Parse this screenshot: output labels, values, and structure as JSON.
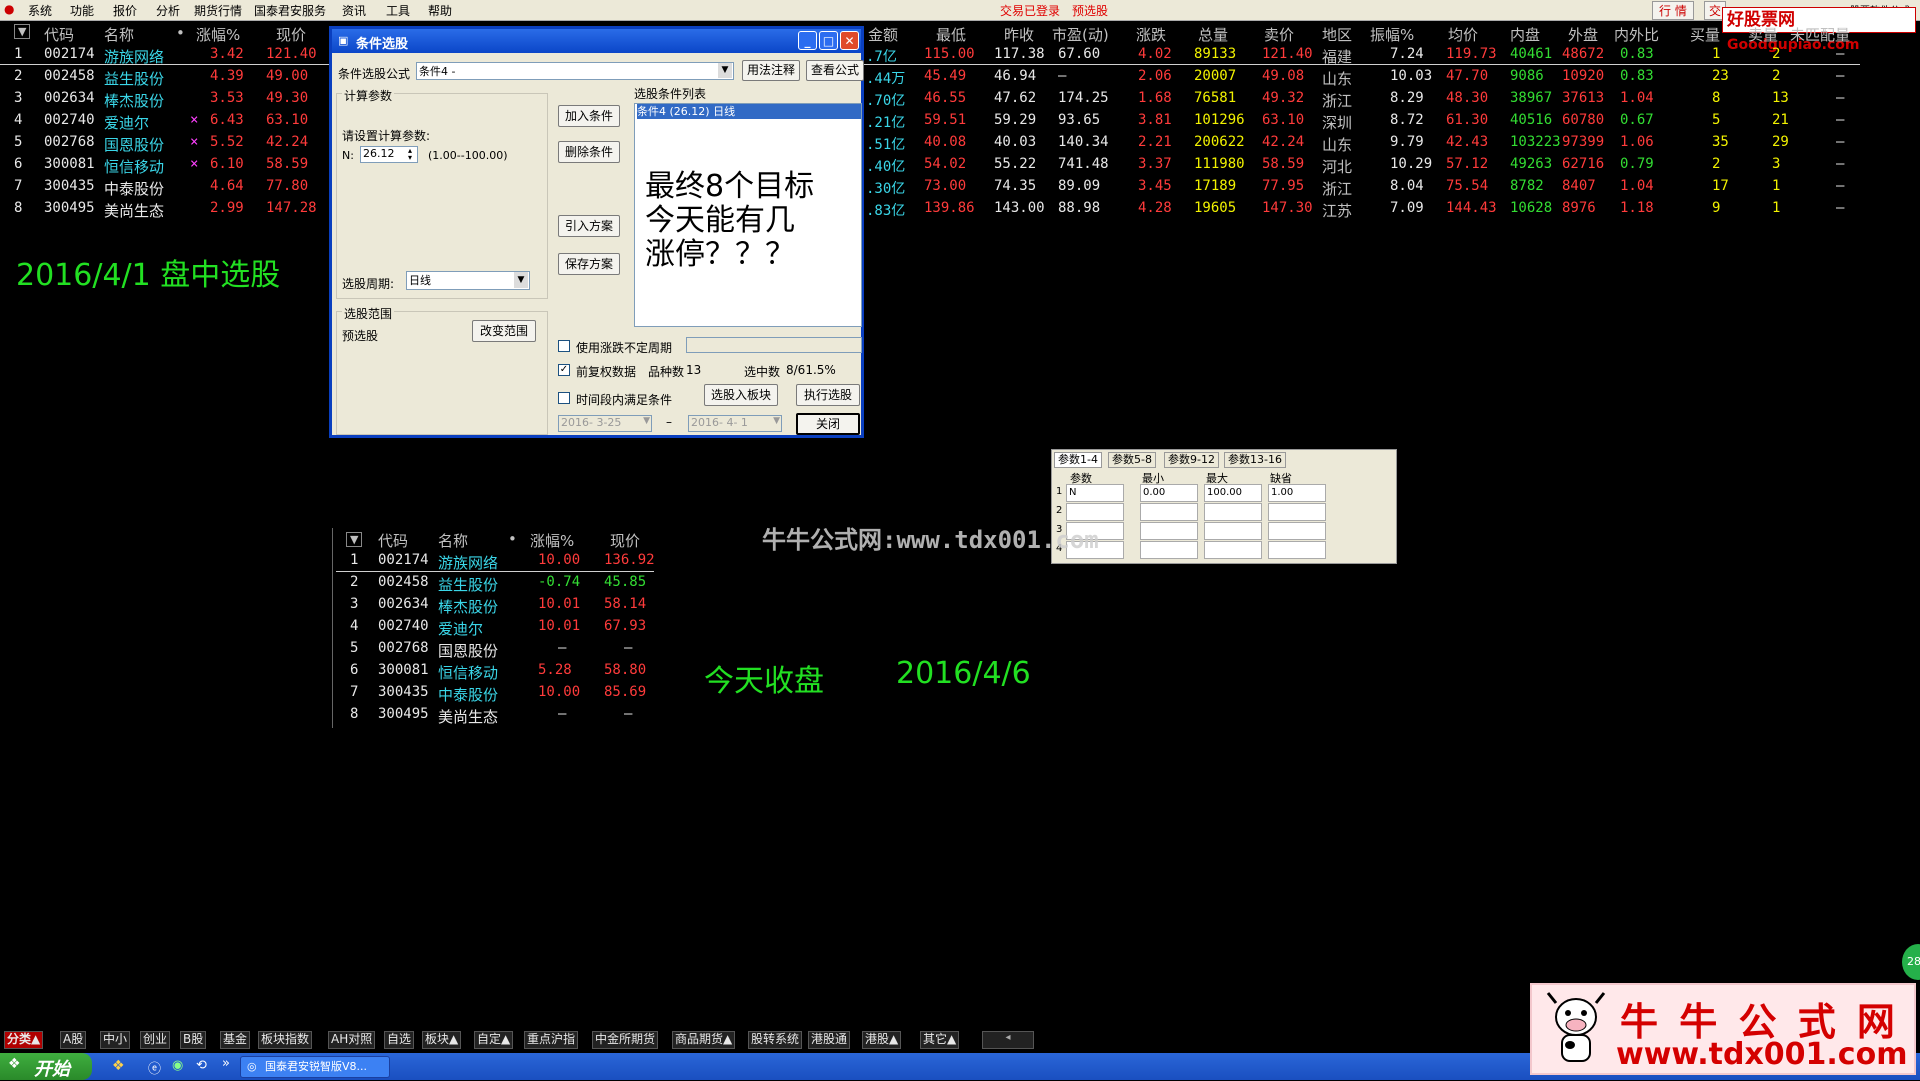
{
  "menubar": {
    "items": [
      "系统",
      "功能",
      "报价",
      "分析",
      "期货行情",
      "国泰君安服务",
      "资讯",
      "工具",
      "帮助"
    ],
    "status_login": "交易已登录",
    "status_pre": "预选股",
    "right_btn1": "行 情",
    "right_btn2": "交",
    "right_text": "股票软件公式"
  },
  "logo_top": {
    "cn": "好股票网",
    "en": "Goodgupiao.com"
  },
  "main_table": {
    "headers_left": [
      "代码",
      "名称",
      "•",
      "涨幅%",
      "现价"
    ],
    "headers_right": [
      "金额",
      "最低",
      "昨收",
      "市盈(动)",
      "涨跌",
      "总量",
      "卖价",
      "地区",
      "振幅%",
      "均价",
      "内盘",
      "外盘",
      "内外比",
      "买量",
      "卖量",
      "未匹配量"
    ],
    "rows": [
      {
        "idx": "1",
        "code": "002174",
        "name": "游族网络",
        "mark": "",
        "chg": "3.42",
        "price": "121.40",
        "amt": ".7亿",
        "low": "115.00",
        "prev": "117.38",
        "pe": "67.60",
        "diff": "4.02",
        "vol": "89133",
        "ask": "121.40",
        "region": "福建",
        "amp": "7.24",
        "avg": "119.73",
        "inner": "40461",
        "outer": "48672",
        "ratio": "0.83",
        "buy": "1",
        "sell": "2",
        "unmatched": "—"
      },
      {
        "idx": "2",
        "code": "002458",
        "name": "益生股份",
        "mark": "",
        "chg": "4.39",
        "price": "49.00",
        "amt": ".44万",
        "low": "45.49",
        "prev": "46.94",
        "pe": "—",
        "diff": "2.06",
        "vol": "20007",
        "ask": "49.08",
        "region": "山东",
        "amp": "10.03",
        "avg": "47.70",
        "inner": "9086",
        "outer": "10920",
        "ratio": "0.83",
        "buy": "23",
        "sell": "2",
        "unmatched": "—"
      },
      {
        "idx": "3",
        "code": "002634",
        "name": "棒杰股份",
        "mark": "",
        "chg": "3.53",
        "price": "49.30",
        "amt": ".70亿",
        "low": "46.55",
        "prev": "47.62",
        "pe": "174.25",
        "diff": "1.68",
        "vol": "76581",
        "ask": "49.32",
        "region": "浙江",
        "amp": "8.29",
        "avg": "48.30",
        "inner": "38967",
        "outer": "37613",
        "ratio": "1.04",
        "buy": "8",
        "sell": "13",
        "unmatched": "—"
      },
      {
        "idx": "4",
        "code": "002740",
        "name": "爱迪尔",
        "mark": "×",
        "chg": "6.43",
        "price": "63.10",
        "amt": ".21亿",
        "low": "59.51",
        "prev": "59.29",
        "pe": "93.65",
        "diff": "3.81",
        "vol": "101296",
        "ask": "63.10",
        "region": "深圳",
        "amp": "8.72",
        "avg": "61.30",
        "inner": "40516",
        "outer": "60780",
        "ratio": "0.67",
        "buy": "5",
        "sell": "21",
        "unmatched": "—"
      },
      {
        "idx": "5",
        "code": "002768",
        "name": "国恩股份",
        "mark": "×",
        "chg": "5.52",
        "price": "42.24",
        "amt": ".51亿",
        "low": "40.08",
        "prev": "40.03",
        "pe": "140.34",
        "diff": "2.21",
        "vol": "200622",
        "ask": "42.24",
        "region": "山东",
        "amp": "9.79",
        "avg": "42.43",
        "inner": "103223",
        "outer": "97399",
        "ratio": "1.06",
        "buy": "35",
        "sell": "29",
        "unmatched": "—"
      },
      {
        "idx": "6",
        "code": "300081",
        "name": "恒信移动",
        "mark": "×",
        "chg": "6.10",
        "price": "58.59",
        "amt": ".40亿",
        "low": "54.02",
        "prev": "55.22",
        "pe": "741.48",
        "diff": "3.37",
        "vol": "111980",
        "ask": "58.59",
        "region": "河北",
        "amp": "10.29",
        "avg": "57.12",
        "inner": "49263",
        "outer": "62716",
        "ratio": "0.79",
        "buy": "2",
        "sell": "3",
        "unmatched": "—"
      },
      {
        "idx": "7",
        "code": "300435",
        "name": "中泰股份",
        "mark": "",
        "chg": "4.64",
        "price": "77.80",
        "amt": ".30亿",
        "low": "73.00",
        "prev": "74.35",
        "pe": "89.09",
        "diff": "3.45",
        "vol": "17189",
        "ask": "77.95",
        "region": "浙江",
        "amp": "8.04",
        "avg": "75.54",
        "inner": "8782",
        "outer": "8407",
        "ratio": "1.04",
        "buy": "17",
        "sell": "1",
        "unmatched": "—"
      },
      {
        "idx": "8",
        "code": "300495",
        "name": "美尚生态",
        "mark": "",
        "chg": "2.99",
        "price": "147.28",
        "amt": ".83亿",
        "low": "139.86",
        "prev": "143.00",
        "pe": "88.98",
        "diff": "4.28",
        "vol": "19605",
        "ask": "147.30",
        "region": "江苏",
        "amp": "7.09",
        "avg": "144.43",
        "inner": "10628",
        "outer": "8976",
        "ratio": "1.18",
        "buy": "9",
        "sell": "1",
        "unmatched": "—"
      }
    ]
  },
  "annotation_left": "2016/4/1  盘中选股",
  "annotation_today": "今天收盘",
  "annotation_today_date": "2016/4/6",
  "dialog": {
    "title": "条件选股",
    "formula_label": "条件选股公式",
    "formula_value": "条件4          -",
    "btn_usage": "用法注释",
    "btn_view": "查看公式",
    "calc_group": "计算参数",
    "calc_prompt": "请设置计算参数:",
    "param_name": "N:",
    "param_value": "26.12",
    "param_range": "(1.00--100.00)",
    "btn_add": "加入条件",
    "btn_delete": "删除条件",
    "btn_import": "引入方案",
    "btn_save": "保存方案",
    "list_label": "选股条件列表",
    "list_item": "条件4 (26.12) 日线",
    "overlay_lines": [
      "最终8个目标",
      "今天能有几",
      "涨停？？？"
    ],
    "period_label": "选股周期:",
    "period_value": "日线",
    "range_group": "选股范围",
    "range_value": "预选股",
    "btn_change_range": "改变范围",
    "chk_uncertain": "使用涨跌不定周期",
    "chk_forward": "前复权数据",
    "species_label": "品种数",
    "species_value": "13",
    "selected_label": "选中数",
    "selected_value": "8/61.5%",
    "chk_period": "时间段内满足条件",
    "btn_to_block": "选股入板块",
    "btn_execute": "执行选股",
    "date_from": "2016- 3-25",
    "date_to": "2016- 4- 1",
    "btn_close": "关闭"
  },
  "param_panel": {
    "tabs": [
      "参数1-4",
      "参数5-8",
      "参数9-12",
      "参数13-16"
    ],
    "headers": [
      "参数",
      "最小",
      "最大",
      "缺省"
    ],
    "rows": [
      {
        "n": "1",
        "name": "N",
        "min": "0.00",
        "max": "100.00",
        "def": "1.00"
      },
      {
        "n": "2",
        "name": "",
        "min": "",
        "max": "",
        "def": ""
      },
      {
        "n": "3",
        "name": "",
        "min": "",
        "max": "",
        "def": ""
      },
      {
        "n": "4",
        "name": "",
        "min": "",
        "max": "",
        "def": ""
      }
    ]
  },
  "watermark_mid": "牛牛公式网:www.tdx001.com",
  "second_table": {
    "headers": [
      "代码",
      "名称",
      "•",
      "涨幅%",
      "现价"
    ],
    "rows": [
      {
        "idx": "1",
        "code": "002174",
        "name": "游族网络",
        "chg": "10.00",
        "price": "136.92",
        "color": "red"
      },
      {
        "idx": "2",
        "code": "002458",
        "name": "益生股份",
        "chg": "-0.74",
        "price": "45.85",
        "color": "green"
      },
      {
        "idx": "3",
        "code": "002634",
        "name": "棒杰股份",
        "chg": "10.01",
        "price": "58.14",
        "color": "red"
      },
      {
        "idx": "4",
        "code": "002740",
        "name": "爱迪尔",
        "chg": "10.01",
        "price": "67.93",
        "color": "red"
      },
      {
        "idx": "5",
        "code": "002768",
        "name": "国恩股份",
        "chg": "—",
        "price": "—",
        "color": "red"
      },
      {
        "idx": "6",
        "code": "300081",
        "name": "恒信移动",
        "chg": "5.28",
        "price": "58.80",
        "color": "red"
      },
      {
        "idx": "7",
        "code": "300435",
        "name": "中泰股份",
        "chg": "10.00",
        "price": "85.69",
        "color": "red"
      },
      {
        "idx": "8",
        "code": "300495",
        "name": "美尚生态",
        "chg": "—",
        "price": "—",
        "color": "red"
      }
    ]
  },
  "bottom_tabs": [
    "分类▲",
    "A股",
    "中小",
    "创业",
    "B股",
    "基金",
    "板块指数",
    "AH对照",
    "自选",
    "板块▲",
    "自定▲",
    "重点沪指",
    "中金所期货",
    "商品期货▲",
    "股转系统",
    "港股通",
    "港股▲",
    "其它▲"
  ],
  "taskbar": {
    "start": "开始",
    "task": "国泰君安锐智版V8..."
  },
  "corner_badge": "28",
  "logo_bottom": {
    "cn": "牛 牛 公 式 网",
    "url": "www.tdx001.com"
  }
}
